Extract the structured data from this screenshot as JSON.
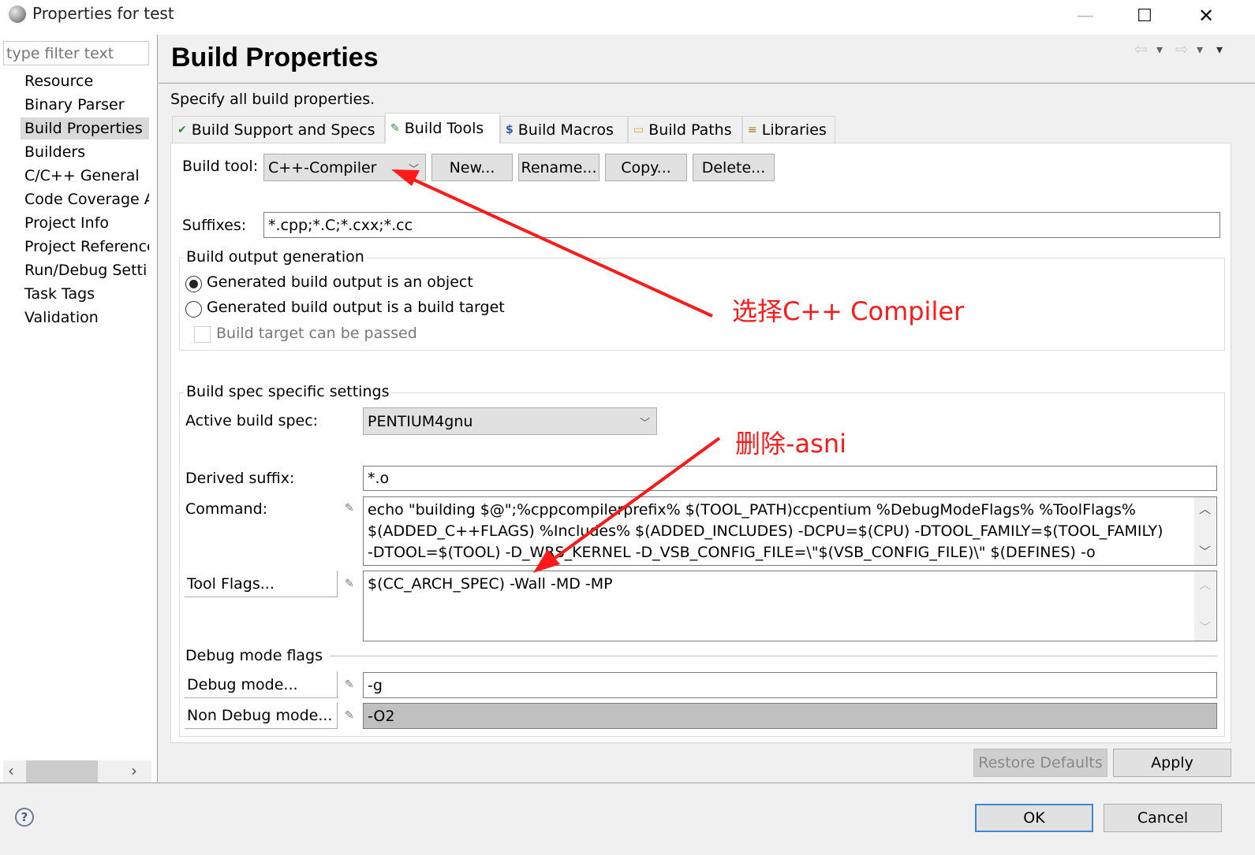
{
  "window": {
    "title": "Properties for test",
    "minimize_glyph": "—",
    "maximize_glyph": "☐",
    "close_glyph": "✕"
  },
  "left_panel": {
    "filter_placeholder": "type filter text",
    "items": [
      {
        "label": "Resource"
      },
      {
        "label": "Binary Parser"
      },
      {
        "label": "Build Properties",
        "selected": true
      },
      {
        "label": "Builders"
      },
      {
        "label": "C/C++ General"
      },
      {
        "label": "Code Coverage A"
      },
      {
        "label": "Project Info"
      },
      {
        "label": "Project Reference"
      },
      {
        "label": "Run/Debug Setti"
      },
      {
        "label": "Task Tags"
      },
      {
        "label": "Validation"
      }
    ],
    "scroll_left": "‹",
    "scroll_right": "›"
  },
  "page": {
    "title": "Build Properties",
    "description": "Specify all build properties.",
    "nav": {
      "back": "⇦",
      "forward": "⇨",
      "dropdown": "▾"
    }
  },
  "tabs": [
    {
      "label": "Build Support and Specs",
      "icon": "✔"
    },
    {
      "label": "Build Tools",
      "icon": "✎",
      "active": true
    },
    {
      "label": "Build Macros",
      "icon": "$"
    },
    {
      "label": "Build Paths",
      "icon": "▭"
    },
    {
      "label": "Libraries",
      "icon": "≡"
    }
  ],
  "build_tools": {
    "build_tool_label": "Build tool:",
    "build_tool_value": "C++-Compiler",
    "buttons": {
      "new": "New...",
      "rename": "Rename...",
      "copy": "Copy...",
      "delete": "Delete..."
    },
    "suffixes_label": "Suffixes:",
    "suffixes_value": "*.cpp;*.C;*.cxx;*.cc",
    "output_group": {
      "title": "Build output generation",
      "option_object": "Generated build output is an object",
      "option_target": "Generated build output is a build target",
      "selected": "object",
      "passthrough_label": "Build target can be passed",
      "passthrough_checked": false
    },
    "spec_group": {
      "title": "Build spec specific settings",
      "active_spec_label": "Active build spec:",
      "active_spec_value": "PENTIUM4gnu",
      "derived_suffix_label": "Derived suffix:",
      "derived_suffix_value": "*.o",
      "command_label": "Command:",
      "command_lines": [
        "echo \"building $@\";%cppcompilerprefix% $(TOOL_PATH)ccpentium %DebugModeFlags% %ToolFlags%",
        "$(ADDED_C++FLAGS) %Includes% $(ADDED_INCLUDES) -DCPU=$(CPU) -DTOOL_FAMILY=$(TOOL_FAMILY)",
        "-DTOOL=$(TOOL) -D_WRS_KERNEL  -D_VSB_CONFIG_FILE=\\\"$(VSB_CONFIG_FILE)\\\"   $(DEFINES) -o"
      ],
      "tool_flags_button": "Tool Flags...",
      "tool_flags_value": "$(CC_ARCH_SPEC) -Wall   -MD -MP"
    },
    "debug_group": {
      "title": "Debug mode flags",
      "debug_button": "Debug mode...",
      "debug_value": "-g",
      "non_debug_button": "Non Debug mode...",
      "non_debug_value": "-O2"
    }
  },
  "annotations": {
    "select_compiler": "选择C++ Compiler",
    "delete_ansi": "删除-asni",
    "color": "#ff1a1a"
  },
  "footer": {
    "restore_defaults": "Restore Defaults",
    "apply": "Apply",
    "ok": "OK",
    "cancel": "Cancel",
    "help_glyph": "?"
  }
}
